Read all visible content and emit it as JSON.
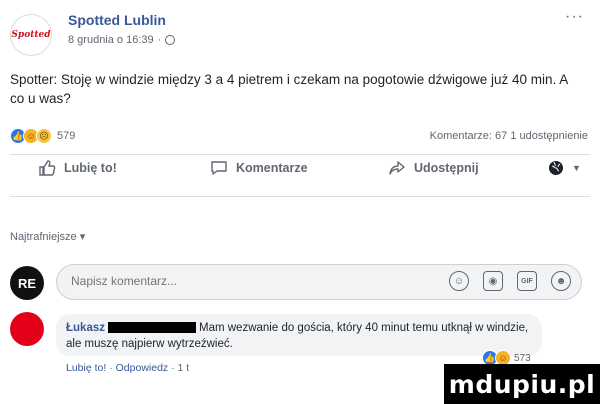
{
  "post": {
    "page_name": "Spotted Lublin",
    "avatar_text": "Spotted",
    "timestamp": "8 grudnia o 16:39",
    "meta_separator": "·",
    "more_label": "···",
    "text": "Spotter: Stoję w windzie między 3 a 4 pietrem i czekam na pogotowie dźwigowe już 40 min. A co u was?",
    "reactions_count": "579",
    "stats": "Komentarze: 67   1 udostępnienie"
  },
  "actions": {
    "like_label": "Lubię to!",
    "comment_label": "Komentarze",
    "share_label": "Udostępnij"
  },
  "comments": {
    "sort_label": "Najtrafniejsze ▾",
    "composer_avatar": "RE",
    "composer_placeholder": "Napisz komentarz...",
    "items": [
      {
        "author": "Łukasz",
        "text": "Mam wezwanie do gościa, który 40 minut temu utknął w windzie, ale muszę najpierw wytrzeźwieć.",
        "like_link": "Lubię to!",
        "reply_link": "Odpowiedz",
        "separator": "·",
        "time": "1 t",
        "reaction_count": "573"
      }
    ]
  },
  "watermark": "mdupiu.pl",
  "colors": {
    "link": "#385898",
    "muted": "#606770",
    "like_blue": "#2078f4"
  },
  "icons": [
    "globe-icon",
    "like-thumb-icon",
    "comment-bubble-icon",
    "share-arrow-icon",
    "emoji-icon",
    "camera-icon",
    "gif-icon",
    "sticker-icon"
  ]
}
